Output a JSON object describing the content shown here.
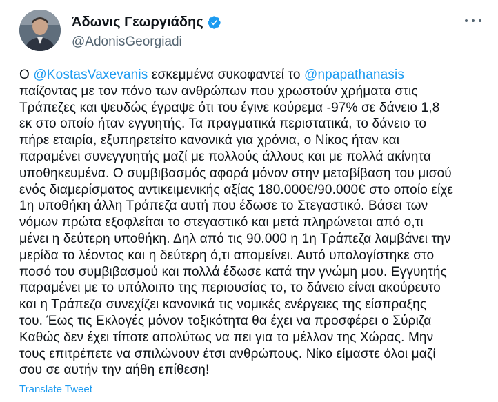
{
  "author": {
    "display_name": "Άδωνις Γεωργιάδης",
    "handle": "@AdonisGeorgiadi",
    "verified": true
  },
  "tweet": {
    "lines": [
      [
        {
          "t": "Ο "
        },
        {
          "t": "@KostasVaxevanis",
          "mention": true
        },
        {
          "t": " εσκεμμένα συκοφαντεί το "
        },
        {
          "t": "@npapathanasis",
          "mention": true
        }
      ],
      [
        {
          "t": "παίζοντας με τον πόνο των ανθρώπων που χρωστούν χρήματα στις"
        }
      ],
      [
        {
          "t": "Τράπεζες και ψευδώς έγραψε ότι του έγινε κούρεμα -97% σε δάνειο 1,8"
        }
      ],
      [
        {
          "t": "εκ στο οποίο ήταν εγγυητής. Τα πραγματικά περιστατικά, το δάνειο το"
        }
      ],
      [
        {
          "t": "πήρε εταιρία, εξυπηρετείτο κανονικά για χρόνια, ο Νίκος ήταν και"
        }
      ],
      [
        {
          "t": "παραμένει συνεγγυητής μαζί με πολλούς άλλους και με πολλά ακίνητα"
        }
      ],
      [
        {
          "t": "υποθηκευμένα. Ο συμβιβασμός αφορά μόνον στην μεταβίβαση του μισού"
        }
      ],
      [
        {
          "t": "ενός διαμερίσματος αντικειμενικής αξίας 180.000€/90.000€ στο οποίο είχε"
        }
      ],
      [
        {
          "t": "1η υποθήκη άλλη Τράπεζα αυτή που έδωσε το Στεγαστικό. Βάσει των"
        }
      ],
      [
        {
          "t": "νόμων πρώτα εξοφλείται το στεγαστικό και μετά πληρώνεται από ο,τι"
        }
      ],
      [
        {
          "t": "μένει η δεύτερη υποθήκη. Δηλ από τις 90.000 η 1η Τράπεζα λαμβάνει την"
        }
      ],
      [
        {
          "t": "μερίδα το λέοντος και η δεύτερη ό,τι απομείνει. Αυτό υπολογίστηκε στο"
        }
      ],
      [
        {
          "t": "ποσό του συμβιβασμού και πολλά έδωσε κατά την γνώμη μου. Εγγυητής"
        }
      ],
      [
        {
          "t": "παραμένει με το υπόλοιπο της περιουσίας το, το δάνειο είναι ακούρευτο"
        }
      ],
      [
        {
          "t": "και η Τράπεζα συνεχίζει κανονικά τις νομικές ενέργειες της είσπραξης"
        }
      ],
      [
        {
          "t": "του. Έως τις Εκλογές μόνον τοξικότητα θα έχει να προσφέρει ο Σύριζα"
        }
      ],
      [
        {
          "t": "Καθώς δεν έχει τίποτε απολύτως να πει για το μέλλον της Χώρας. Μην"
        }
      ],
      [
        {
          "t": "τους επιτρέπετε να σπιλώνουν έτσι ανθρώπους. Νίκο είμαστε όλοι μαζί"
        }
      ],
      [
        {
          "t": "σου σε αυτήν την αήθη επίθεση!"
        }
      ]
    ]
  },
  "translate_label": "Translate Tweet",
  "colors": {
    "link": "#1d9bf0",
    "text": "#0f1419",
    "secondary": "#536471",
    "verified_badge": "#1d9bf0"
  },
  "icons": {
    "verified": "verified-badge-icon",
    "more": "more-options-icon"
  }
}
